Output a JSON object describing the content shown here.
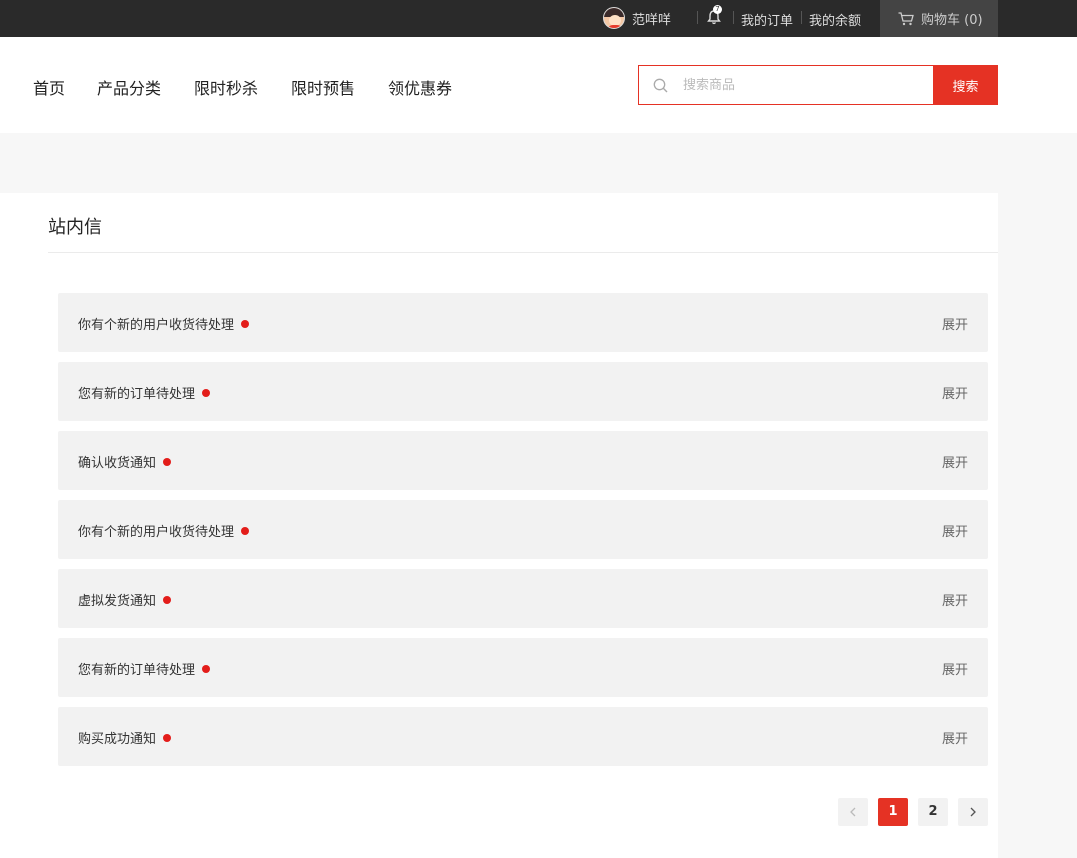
{
  "topbar": {
    "user_name": "范咩咩",
    "bell_count": "7",
    "links": [
      "我的订单",
      "我的余额"
    ],
    "cart_label": "购物车 (0)"
  },
  "nav": {
    "items": [
      "首页",
      "产品分类",
      "限时秒杀",
      "限时预售",
      "领优惠券"
    ]
  },
  "search": {
    "placeholder": "搜索商品",
    "button_label": "搜索"
  },
  "panel": {
    "title": "站内信",
    "expand_label": "展开",
    "messages": [
      {
        "title": "你有个新的用户收货待处理"
      },
      {
        "title": "您有新的订单待处理"
      },
      {
        "title": "确认收货通知"
      },
      {
        "title": "你有个新的用户收货待处理"
      },
      {
        "title": "虚拟发货通知"
      },
      {
        "title": "您有新的订单待处理"
      },
      {
        "title": "购买成功通知"
      }
    ]
  },
  "pagination": {
    "pages": [
      "1",
      "2"
    ],
    "current": "1"
  },
  "colors": {
    "accent": "#e53224",
    "topbar_bg": "#2a2a2a",
    "unread_dot": "#e31d1a"
  }
}
